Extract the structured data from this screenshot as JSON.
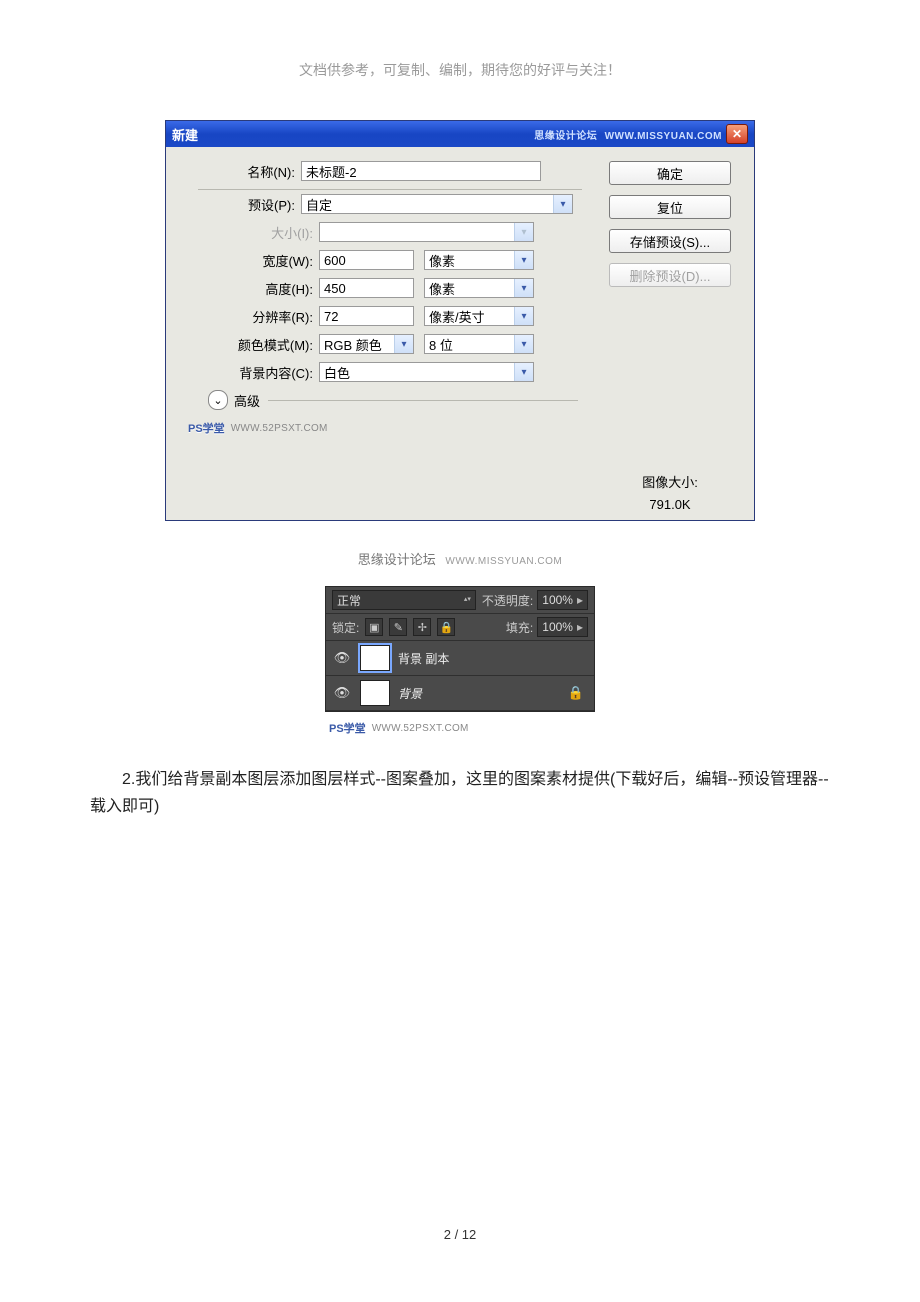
{
  "header_note": "文档供参考，可复制、编制，期待您的好评与关注！",
  "dialog": {
    "title": "新建",
    "brand_text": "思缘设计论坛",
    "brand_url": "WWW.MISSYUAN.COM",
    "fields": {
      "name_label": "名称(N):",
      "name_value": "未标题-2",
      "preset_label": "预设(P):",
      "preset_value": "自定",
      "size_label": "大小(I):",
      "width_label": "宽度(W):",
      "width_value": "600",
      "width_unit": "像素",
      "height_label": "高度(H):",
      "height_value": "450",
      "height_unit": "像素",
      "res_label": "分辨率(R):",
      "res_value": "72",
      "res_unit": "像素/英寸",
      "mode_label": "颜色模式(M):",
      "mode_value": "RGB 颜色",
      "depth_value": "8 位",
      "bg_label": "背景内容(C):",
      "bg_value": "白色",
      "advanced_label": "高级"
    },
    "buttons": {
      "ok": "确定",
      "reset": "复位",
      "save_preset": "存储预设(S)...",
      "delete_preset": "删除预设(D)..."
    },
    "image_size_label": "图像大小:",
    "image_size_value": "791.0K",
    "watermark_badge": "PS学堂",
    "watermark_url": "WWW.52PSXT.COM"
  },
  "mid_caption": {
    "text": "思缘设计论坛",
    "url": "WWW.MISSYUAN.COM"
  },
  "layers": {
    "blend_mode": "正常",
    "opacity_label": "不透明度:",
    "opacity_value": "100%",
    "lock_label": "锁定:",
    "fill_label": "填充:",
    "fill_value": "100%",
    "items": [
      {
        "name": "背景 副本",
        "locked": false
      },
      {
        "name": "背景",
        "locked": true
      }
    ],
    "watermark_badge": "PS学堂",
    "watermark_url": "WWW.52PSXT.COM"
  },
  "body_text": "2.我们给背景副本图层添加图层样式--图案叠加，这里的图案素材提供(下载好后，编辑--预设管理器--载入即可)",
  "footer": "2  / 12"
}
